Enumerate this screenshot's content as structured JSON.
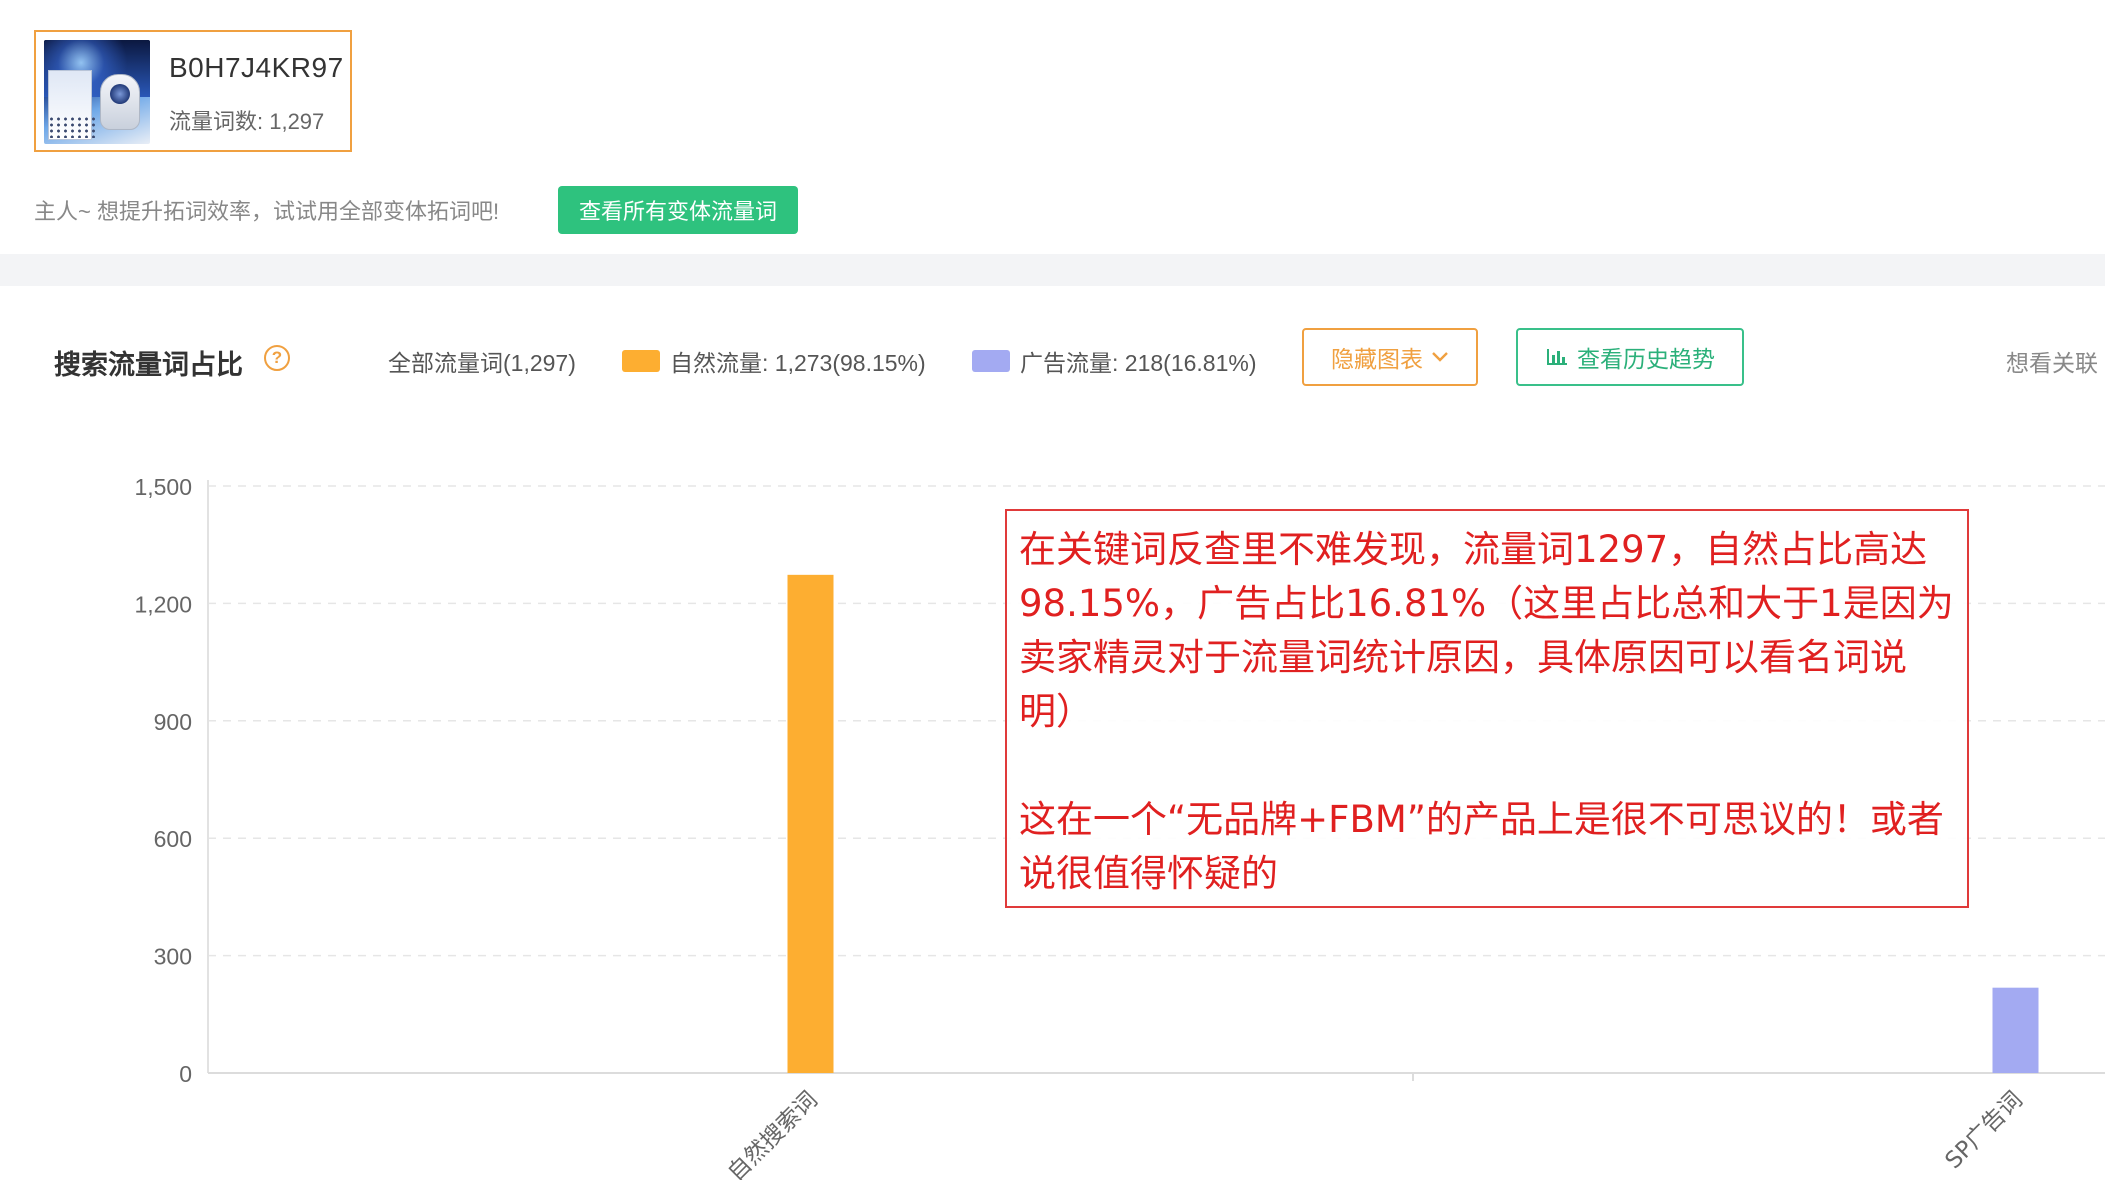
{
  "product": {
    "asin": "B0H7J4KR97",
    "keyword_count_label": "流量词数: 1,297"
  },
  "tip": {
    "text": "主人~ 想提升拓词效率，试试用全部变体拓词吧!",
    "button_label": "查看所有变体流量词"
  },
  "section": {
    "title": "搜索流量词占比",
    "help_icon_glyph": "?",
    "filter_all_label": "全部流量词(1,297)",
    "legend": [
      {
        "label": "自然流量: 1,273(98.15%)",
        "color": "#fdae31"
      },
      {
        "label": "广告流量: 218(16.81%)",
        "color": "#a3aaf2"
      }
    ],
    "hide_chart_label": "隐藏图表",
    "history_label": "查看历史趋势",
    "related_label": "想看关联"
  },
  "chart_data": {
    "type": "bar",
    "categories": [
      "自然搜索词",
      "SP广告词"
    ],
    "values": [
      1273,
      218
    ],
    "colors": [
      "#fdae31",
      "#a3aaf2"
    ],
    "ylim": [
      0,
      1500
    ],
    "yticks": [
      "1,500",
      "1,200",
      "900",
      "600",
      "300",
      "0"
    ],
    "ytick_values": [
      1500,
      1200,
      900,
      600,
      300,
      0
    ],
    "grid": true,
    "title": "",
    "xlabel": "",
    "ylabel": ""
  },
  "annotation": {
    "paragraph1": "在关键词反查里不难发现，流量词1297，自然占比高达98.15%，广告占比16.81%（这里占比总和大于1是因为卖家精灵对于流量词统计原因，具体原因可以看名词说明）",
    "paragraph2": "这在一个“无品牌+FBM”的产品上是很不可思议的！或者说很值得怀疑的",
    "color": "#e02020"
  }
}
